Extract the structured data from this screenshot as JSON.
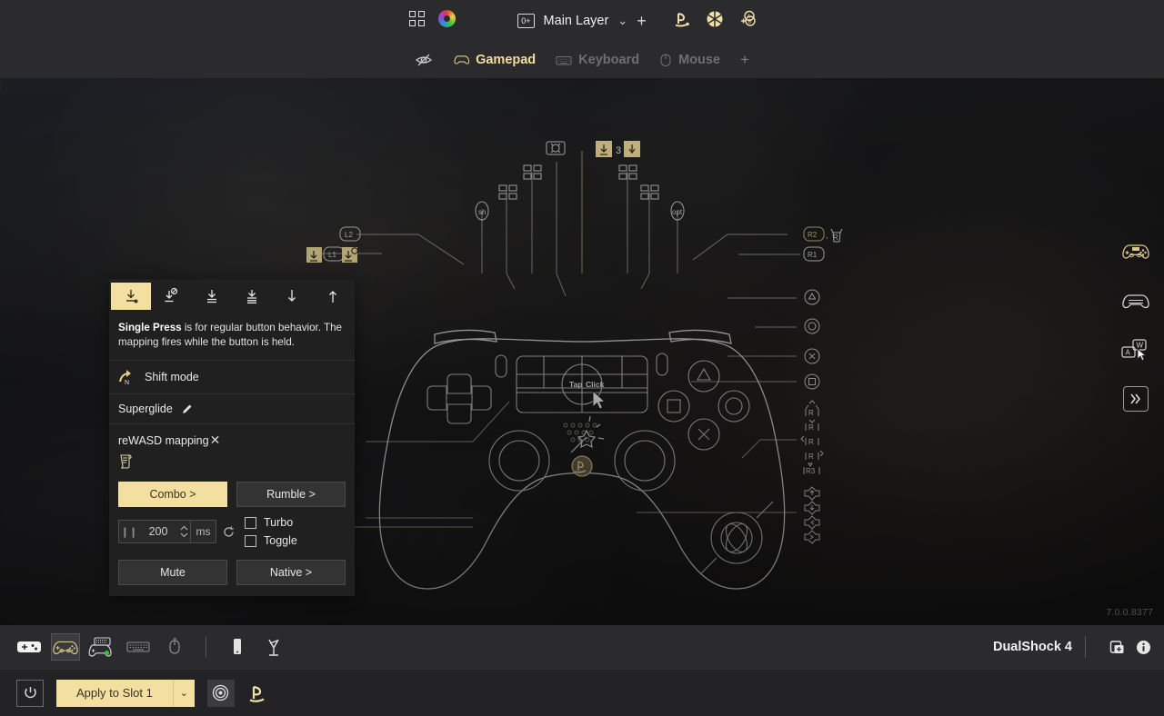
{
  "app": {
    "version": "7.0.0.8377",
    "device_name": "DualShock 4"
  },
  "header": {
    "icons": {
      "grid": "grid-icon",
      "color_wheel": "color-wheel-icon",
      "playstation": "playstation-icon",
      "wheel": "pie-wheel-icon",
      "add_mapping": "add-association-icon"
    },
    "layer": {
      "badge": "0+",
      "name": "Main Layer",
      "dropdown": "⌄",
      "add": "+"
    },
    "tabs": [
      {
        "label": "Gamepad",
        "icon": "gamepad-icon",
        "active": true
      },
      {
        "label": "Keyboard",
        "icon": "keyboard-icon",
        "active": false
      },
      {
        "label": "Mouse",
        "icon": "mouse-icon",
        "active": false
      }
    ],
    "tab_add": "+",
    "visibility_toggle": "eye-off-icon"
  },
  "panel": {
    "modes": [
      {
        "name": "single-press",
        "selected": true
      },
      {
        "name": "long-press",
        "selected": false
      },
      {
        "name": "double-press",
        "selected": false
      },
      {
        "name": "triple-press",
        "selected": false
      },
      {
        "name": "press-down",
        "selected": false
      },
      {
        "name": "press-up",
        "selected": false
      }
    ],
    "description_title": "Single Press",
    "description_rest": " is for regular button behavior. The mapping fires while the button is held.",
    "shift_mode_label": "Shift mode",
    "shift_mode_badge": "N",
    "preset_name": "Superglide",
    "mapping_label": "reWASD mapping",
    "mapping_close": "✕",
    "combo_label": "Combo >",
    "rumble_label": "Rumble >",
    "turbo_label": "Turbo",
    "toggle_label": "Toggle",
    "turbo_value": "200",
    "turbo_unit": "ms",
    "mute_label": "Mute",
    "native_label": "Native >"
  },
  "gamepad": {
    "touchpad_tap": "Tap",
    "touchpad_click": "Click",
    "top_center_count": "3",
    "labels": {
      "l2": "L2",
      "l1": "L1",
      "r2": "R2",
      "r1": "R1",
      "r3": "R3",
      "share": "share",
      "options": "opt"
    }
  },
  "right_rail": [
    {
      "name": "ps4-controller-icon",
      "active": true
    },
    {
      "name": "generic-controller-icon",
      "active": false
    },
    {
      "name": "keyboard-mouse-icon",
      "active": false
    },
    {
      "name": "expand-panel-icon",
      "active": false
    }
  ],
  "bottom_bar": {
    "icons": [
      {
        "name": "add-device-icon",
        "selected": false
      },
      {
        "name": "gamepad-device-icon",
        "selected": true
      },
      {
        "name": "gamepad-keyboard-icon",
        "selected": false
      },
      {
        "name": "keyboard-device-icon",
        "selected": false
      },
      {
        "name": "mouse-device-icon",
        "selected": false
      },
      {
        "name": "phone-device-icon",
        "selected": false
      },
      {
        "name": "virtual-device-icon",
        "selected": false
      }
    ],
    "device_actions": [
      {
        "name": "duplicate-device-icon"
      },
      {
        "name": "device-info-icon"
      }
    ]
  },
  "apply_bar": {
    "power_icon": "power-icon",
    "apply_label": "Apply to Slot 1",
    "apply_dropdown": "⌄",
    "target_icon": "target-icon",
    "playstation_icon": "playstation-icon"
  }
}
